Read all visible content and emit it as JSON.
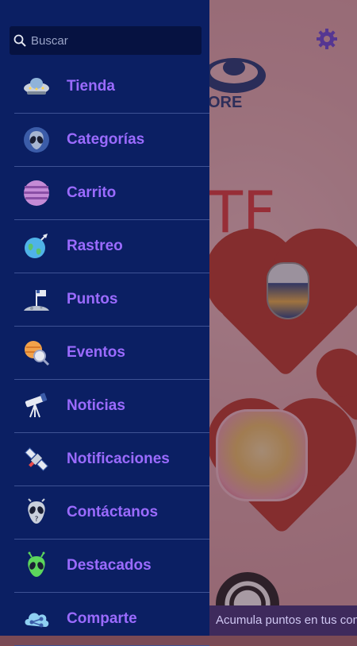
{
  "app": {
    "settings_icon": "gear-icon",
    "accent_color": "#9b6bff",
    "drawer_color": "#0b1f63"
  },
  "background": {
    "logo_text": "ORE",
    "big_letter": "TF",
    "banner_text": "Acumula  puntos en tus com"
  },
  "search": {
    "placeholder": "Buscar",
    "icon": "search-icon"
  },
  "menu": {
    "items": [
      {
        "label": "Tienda",
        "icon": "ufo-icon"
      },
      {
        "label": "Categorías",
        "icon": "alien-head-icon"
      },
      {
        "label": "Carrito",
        "icon": "planet-icon"
      },
      {
        "label": "Rastreo",
        "icon": "earth-rocket-icon"
      },
      {
        "label": "Puntos",
        "icon": "moon-flag-icon"
      },
      {
        "label": "Eventos",
        "icon": "planet-magnifier-icon"
      },
      {
        "label": "Noticias",
        "icon": "telescope-icon"
      },
      {
        "label": "Notificaciones",
        "icon": "satellite-icon"
      },
      {
        "label": "Contáctanos",
        "icon": "alien-contact-icon"
      },
      {
        "label": "Destacados",
        "icon": "green-alien-icon"
      },
      {
        "label": "Comparte",
        "icon": "share-cloud-icon"
      }
    ]
  }
}
